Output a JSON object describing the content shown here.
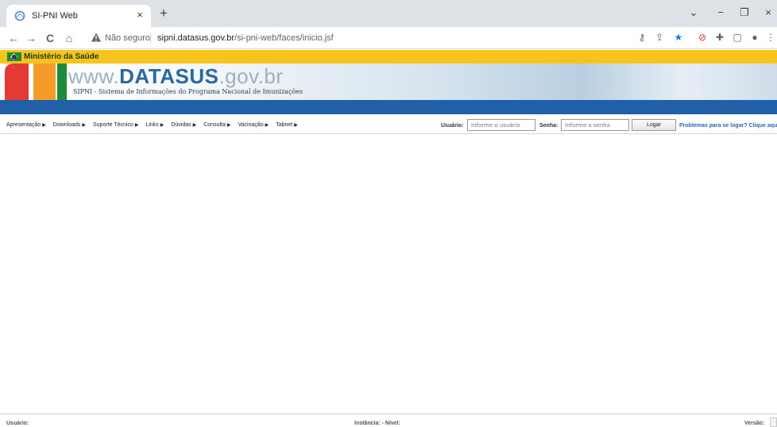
{
  "browser": {
    "tab_title": "SI-PNI Web",
    "tab_close": "×",
    "new_tab": "+",
    "nav": {
      "back": "←",
      "forward": "→",
      "reload": "C",
      "home": "⌂"
    },
    "security_label": "Não seguro",
    "url_host": "sipni.datasus.gov.br",
    "url_path": "/si-pni-web/faces/inicio.jsf",
    "window_controls": {
      "dropdown": "⌄",
      "minimize": "−",
      "restore": "❐",
      "close": "×"
    },
    "icons": [
      "key-icon",
      "share-icon",
      "bookmark-star-icon",
      "extension-red-icon",
      "puzzle-icon",
      "sidepanel-icon",
      "profile-icon",
      "menu-icon"
    ]
  },
  "site": {
    "ministry": "Ministério da Saúde",
    "logo": {
      "www": "www.",
      "brand": "DATASUS",
      "tld": ".gov.br"
    },
    "subtitle": "SIPNI - Sistema de Informações do Programa Nacional de Imunizações",
    "colors": {
      "gov_bar": "#f6c41c",
      "blue_strip": "#2060a8",
      "red": "#e53935",
      "orange": "#f39c2a",
      "green": "#1e8a3a",
      "link": "#2d68b0"
    }
  },
  "menu": [
    {
      "label": "Apresentação"
    },
    {
      "label": "Downloads"
    },
    {
      "label": "Suporte Técnico"
    },
    {
      "label": "Links"
    },
    {
      "label": "Dúvidas"
    },
    {
      "label": "Consulta"
    },
    {
      "label": "Vacinação"
    },
    {
      "label": "Tabnet"
    }
  ],
  "login": {
    "user_label": "Usuário:",
    "user_placeholder": "Informe o usuário",
    "password_label": "Senha:",
    "password_placeholder": "Informe a senha",
    "button_label": "Logar",
    "help_link": "Problemas para se logar? Clique aqui"
  },
  "status": {
    "user_label": "Usuário:",
    "instance_label": "Instância: - Nível:",
    "version_label": "Versão:"
  }
}
